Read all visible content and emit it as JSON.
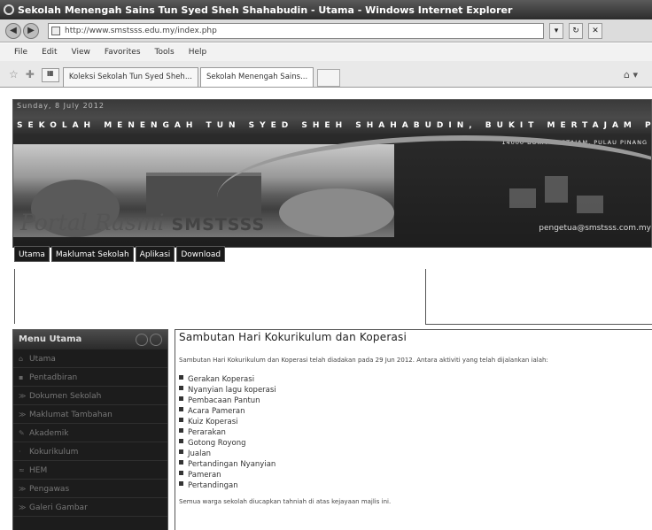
{
  "window": {
    "title": "Sekolah Menengah Sains Tun Syed Sheh Shahabudin - Utama - Windows Internet Explorer"
  },
  "address_bar": {
    "url": "http://www.smstsss.edu.my/index.php"
  },
  "menu": {
    "items": [
      "File",
      "Edit",
      "View",
      "Favorites",
      "Tools",
      "Help"
    ]
  },
  "tabs": [
    {
      "label": "Koleksi Sekolah Tun Syed Sheh...",
      "active": false
    },
    {
      "label": "Sekolah Menengah Sains...",
      "active": true
    }
  ],
  "banner": {
    "date": "Sunday, 8 July 2012",
    "school_name": "SEKOLAH MENENGAH TUN SYED SHEH SHAHABUDIN, BUKIT MERTAJAM PULAU PINANG",
    "address": "14000 BUKIT MERTAJAM, PULAU PINANG",
    "portal_script": "Portal Rasmi",
    "portal_abbr": "SMSTSSS",
    "email": "pengetua@smstsss.com.my"
  },
  "top_nav": [
    "Utama",
    "Maklumat Sekolah",
    "Aplikasi",
    "Download"
  ],
  "sidebar": {
    "title": "Menu Utama",
    "items": [
      {
        "label": "Utama",
        "icon": "home-icon"
      },
      {
        "label": "Pentadbiran",
        "icon": "admin-icon"
      },
      {
        "label": "Dokumen Sekolah",
        "icon": "document-icon"
      },
      {
        "label": "Maklumat Tambahan",
        "icon": "info-icon"
      },
      {
        "label": "Akademik",
        "icon": "academic-icon"
      },
      {
        "label": "Kokurikulum",
        "icon": "cocurriculum-icon"
      },
      {
        "label": "HEM",
        "icon": "hem-icon"
      },
      {
        "label": "Pengawas",
        "icon": "prefect-icon"
      },
      {
        "label": "Galeri Gambar",
        "icon": "gallery-icon"
      }
    ]
  },
  "content": {
    "title": "Sambutan Hari Kokurikulum dan Koperasi",
    "intro": "Sambutan Hari Kokurikulum dan Koperasi telah diadakan pada 29 Jun 2012. Antara aktiviti yang telah dijalankan ialah:",
    "list": [
      "Gerakan Koperasi",
      "Nyanyian lagu koperasi",
      "Pembacaan Pantun",
      "Acara Pameran",
      "Kuiz Koperasi",
      "Perarakan",
      "Gotong Royong",
      "Jualan",
      "Pertandingan Nyanyian",
      "Pameran",
      "Pertandingan"
    ],
    "outro": "Semua warga sekolah diucapkan tahniah di atas kejayaan majlis ini."
  }
}
